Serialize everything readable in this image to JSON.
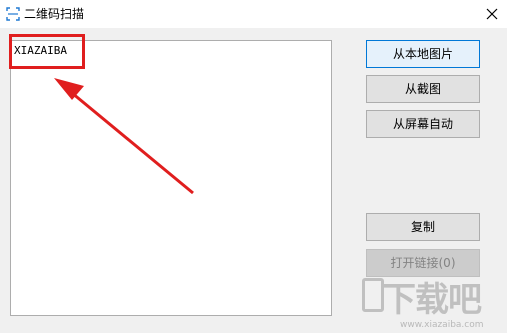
{
  "window": {
    "title": "二维码扫描",
    "close_symbol": "✕"
  },
  "result": {
    "text": "XIAZAIBA"
  },
  "buttons": {
    "from_local_image": "从本地图片",
    "from_screenshot": "从截图",
    "from_screen_auto": "从屏幕自动",
    "copy": "复制",
    "open_link": "打开链接(0)"
  },
  "annotation": {
    "color": "#e01e1e"
  },
  "watermark": {
    "brand": "下载吧",
    "url": "www.xiazaiba.com"
  },
  "colors": {
    "window_bg": "#f0f0f0",
    "titlebar_bg": "#ffffff",
    "primary_border": "#0078d7"
  },
  "icons": {
    "app": "qr-scan-icon",
    "close": "close-icon"
  }
}
